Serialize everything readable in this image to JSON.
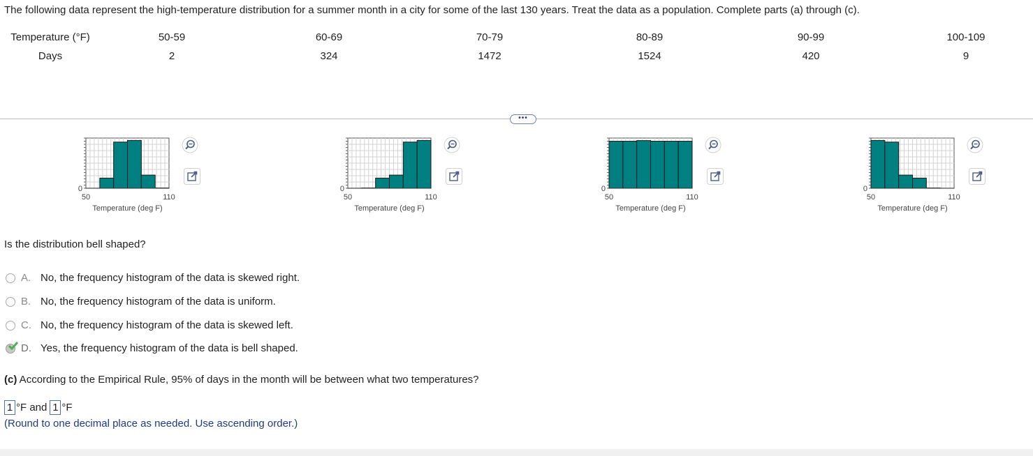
{
  "intro": "The following data represent the high-temperature distribution for a summer month in a city for some of the last 130 years. Treat the data as a population. Complete parts (a) through (c).",
  "table": {
    "row1_label": "Temperature (°F)",
    "row2_label": "Days",
    "classes": [
      "50-59",
      "60-69",
      "70-79",
      "80-89",
      "90-99",
      "100-109"
    ],
    "days": [
      "2",
      "324",
      "1472",
      "1524",
      "420",
      "9"
    ]
  },
  "more_button": "•••",
  "histograms": [
    {
      "name": "histogram-a",
      "values": [
        2,
        324,
        1472,
        1524,
        420,
        9
      ],
      "x_start": "50",
      "x_end": "110",
      "xlabel": "Temperature (deg F)",
      "y_zero": "0"
    },
    {
      "name": "histogram-b",
      "values": [
        2,
        9,
        324,
        420,
        1472,
        1524
      ],
      "x_start": "50",
      "x_end": "110",
      "xlabel": "Temperature (deg F)",
      "y_zero": "0"
    },
    {
      "name": "histogram-c",
      "values": [
        1500,
        1500,
        1520,
        1500,
        1500,
        1500
      ],
      "x_start": "50",
      "x_end": "110",
      "xlabel": "Temperature (deg F)",
      "y_zero": "0"
    },
    {
      "name": "histogram-d",
      "values": [
        1524,
        1472,
        420,
        324,
        9,
        2
      ],
      "x_start": "50",
      "x_end": "110",
      "xlabel": "Temperature (deg F)",
      "y_zero": "0"
    }
  ],
  "question": "Is the distribution bell shaped?",
  "options": [
    {
      "letter": "A.",
      "text": "No, the frequency histogram of the data is skewed right.",
      "selected": false
    },
    {
      "letter": "B.",
      "text": "No, the frequency histogram of the data is uniform.",
      "selected": false
    },
    {
      "letter": "C.",
      "text": "No, the frequency histogram of the data is skewed left.",
      "selected": false
    },
    {
      "letter": "D.",
      "text": "Yes, the frequency histogram of the data is bell shaped.",
      "selected": true
    }
  ],
  "part_c": {
    "label": "(c)",
    "text": " According to the Empirical Rule, 95% of days in the month will be between what two temperatures?",
    "answer1": "1",
    "unit1": "°F and",
    "answer2": "1",
    "unit2": "°F",
    "hint": "(Round to one decimal place as needed. Use ascending order.)"
  },
  "colors": {
    "bar_fill": "#008080",
    "accent": "#1f3a88",
    "check": "#4caf50"
  }
}
